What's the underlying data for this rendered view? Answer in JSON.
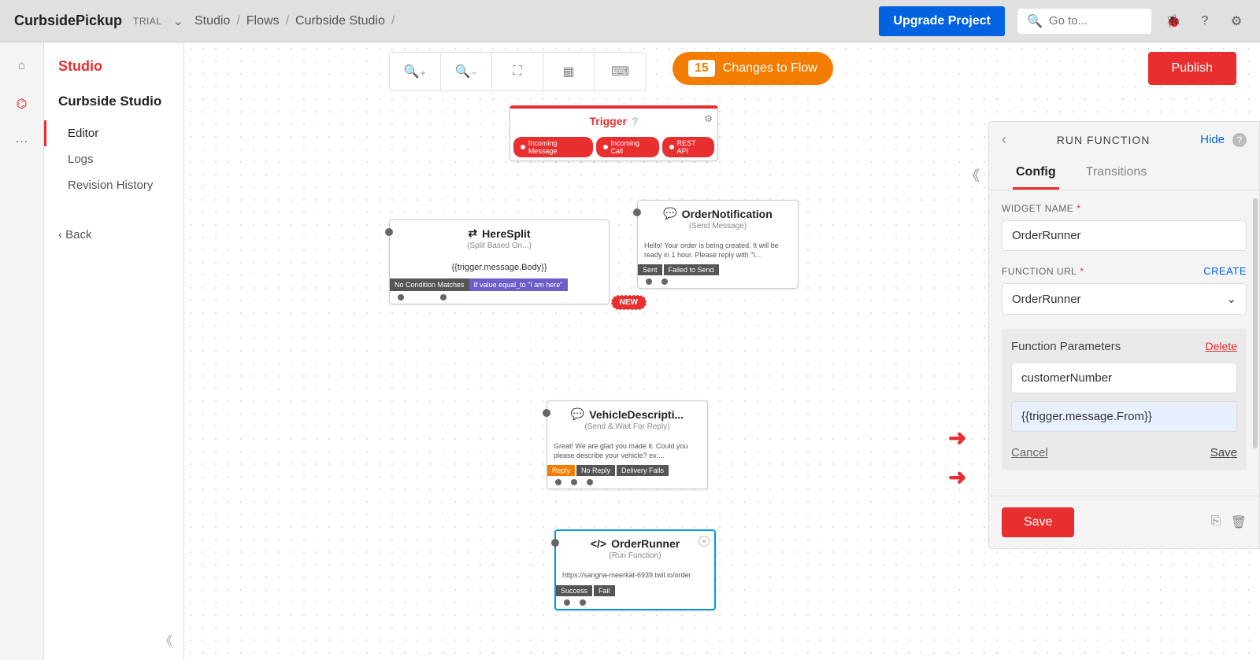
{
  "header": {
    "project": "CurbsidePickup",
    "trial": "TRIAL",
    "breadcrumbs": [
      "Studio",
      "Flows",
      "Curbside Studio"
    ],
    "upgrade": "Upgrade Project",
    "search_placeholder": "Go to..."
  },
  "sidebar": {
    "title": "Studio",
    "subtitle": "Curbside Studio",
    "items": [
      "Editor",
      "Logs",
      "Revision History"
    ],
    "back": "‹ Back"
  },
  "toolbar": {
    "changes_count": "15",
    "changes_label": "Changes to Flow",
    "publish": "Publish"
  },
  "nodes": {
    "trigger": {
      "title": "Trigger",
      "ports": [
        "Incoming Message",
        "Incoming Call",
        "REST API"
      ]
    },
    "heresplit": {
      "title": "HereSplit",
      "sub": "(Split Based On...)",
      "body": "{{trigger.message.Body}}",
      "tags": [
        "No Condition Matches",
        "If value equal_to \"I am here\""
      ],
      "new": "NEW"
    },
    "ordernotif": {
      "title": "OrderNotification",
      "sub": "(Send Message)",
      "body": "Hello! Your order is being created. It will be ready in 1 hour. Please reply with \"I...",
      "tags": [
        "Sent",
        "Failed to Send"
      ]
    },
    "vehicledesc": {
      "title": "VehicleDescripti...",
      "sub": "(Send & Wait For Reply)",
      "body": "Great! We are glad you made it. Could you please describe your vehicle? ex:...",
      "tags": [
        "Reply",
        "No Reply",
        "Delivery Fails"
      ]
    },
    "orderrunner": {
      "title": "OrderRunner",
      "sub": "(Run Function)",
      "body": "https://sangria-meerkat-6939.twil.io/order",
      "tags": [
        "Success",
        "Fail"
      ]
    }
  },
  "panel": {
    "title": "RUN FUNCTION",
    "hide": "Hide",
    "tabs": [
      "Config",
      "Transitions"
    ],
    "widget_name_label": "WIDGET NAME",
    "widget_name": "OrderRunner",
    "func_url_label": "FUNCTION URL",
    "create": "CREATE",
    "func_url": "OrderRunner",
    "params_title": "Function Parameters",
    "delete": "Delete",
    "param_key": "customerNumber",
    "param_val": "{{trigger.message.From}}",
    "cancel": "Cancel",
    "save_u": "Save",
    "save": "Save"
  }
}
